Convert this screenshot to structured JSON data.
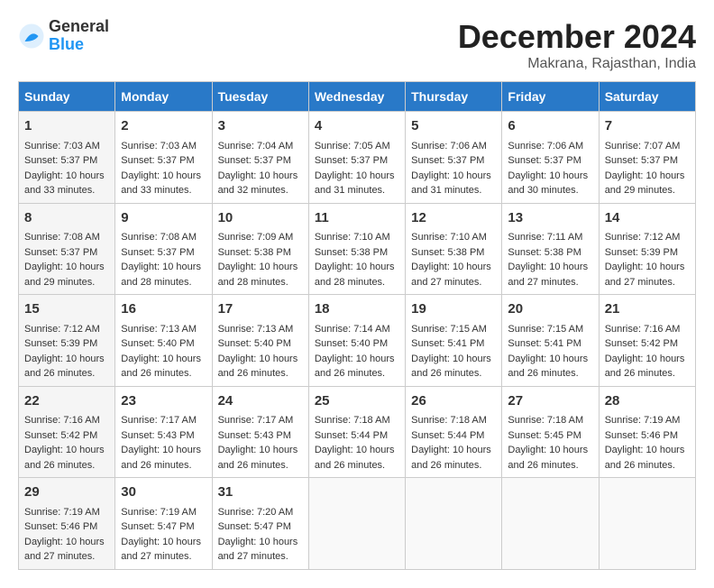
{
  "header": {
    "logo_line1": "General",
    "logo_line2": "Blue",
    "month": "December 2024",
    "location": "Makrana, Rajasthan, India"
  },
  "weekdays": [
    "Sunday",
    "Monday",
    "Tuesday",
    "Wednesday",
    "Thursday",
    "Friday",
    "Saturday"
  ],
  "weeks": [
    [
      {
        "day": "1",
        "lines": [
          "Sunrise: 7:03 AM",
          "Sunset: 5:37 PM",
          "Daylight: 10 hours",
          "and 33 minutes."
        ]
      },
      {
        "day": "2",
        "lines": [
          "Sunrise: 7:03 AM",
          "Sunset: 5:37 PM",
          "Daylight: 10 hours",
          "and 33 minutes."
        ]
      },
      {
        "day": "3",
        "lines": [
          "Sunrise: 7:04 AM",
          "Sunset: 5:37 PM",
          "Daylight: 10 hours",
          "and 32 minutes."
        ]
      },
      {
        "day": "4",
        "lines": [
          "Sunrise: 7:05 AM",
          "Sunset: 5:37 PM",
          "Daylight: 10 hours",
          "and 31 minutes."
        ]
      },
      {
        "day": "5",
        "lines": [
          "Sunrise: 7:06 AM",
          "Sunset: 5:37 PM",
          "Daylight: 10 hours",
          "and 31 minutes."
        ]
      },
      {
        "day": "6",
        "lines": [
          "Sunrise: 7:06 AM",
          "Sunset: 5:37 PM",
          "Daylight: 10 hours",
          "and 30 minutes."
        ]
      },
      {
        "day": "7",
        "lines": [
          "Sunrise: 7:07 AM",
          "Sunset: 5:37 PM",
          "Daylight: 10 hours",
          "and 29 minutes."
        ]
      }
    ],
    [
      {
        "day": "8",
        "lines": [
          "Sunrise: 7:08 AM",
          "Sunset: 5:37 PM",
          "Daylight: 10 hours",
          "and 29 minutes."
        ]
      },
      {
        "day": "9",
        "lines": [
          "Sunrise: 7:08 AM",
          "Sunset: 5:37 PM",
          "Daylight: 10 hours",
          "and 28 minutes."
        ]
      },
      {
        "day": "10",
        "lines": [
          "Sunrise: 7:09 AM",
          "Sunset: 5:38 PM",
          "Daylight: 10 hours",
          "and 28 minutes."
        ]
      },
      {
        "day": "11",
        "lines": [
          "Sunrise: 7:10 AM",
          "Sunset: 5:38 PM",
          "Daylight: 10 hours",
          "and 28 minutes."
        ]
      },
      {
        "day": "12",
        "lines": [
          "Sunrise: 7:10 AM",
          "Sunset: 5:38 PM",
          "Daylight: 10 hours",
          "and 27 minutes."
        ]
      },
      {
        "day": "13",
        "lines": [
          "Sunrise: 7:11 AM",
          "Sunset: 5:38 PM",
          "Daylight: 10 hours",
          "and 27 minutes."
        ]
      },
      {
        "day": "14",
        "lines": [
          "Sunrise: 7:12 AM",
          "Sunset: 5:39 PM",
          "Daylight: 10 hours",
          "and 27 minutes."
        ]
      }
    ],
    [
      {
        "day": "15",
        "lines": [
          "Sunrise: 7:12 AM",
          "Sunset: 5:39 PM",
          "Daylight: 10 hours",
          "and 26 minutes."
        ]
      },
      {
        "day": "16",
        "lines": [
          "Sunrise: 7:13 AM",
          "Sunset: 5:40 PM",
          "Daylight: 10 hours",
          "and 26 minutes."
        ]
      },
      {
        "day": "17",
        "lines": [
          "Sunrise: 7:13 AM",
          "Sunset: 5:40 PM",
          "Daylight: 10 hours",
          "and 26 minutes."
        ]
      },
      {
        "day": "18",
        "lines": [
          "Sunrise: 7:14 AM",
          "Sunset: 5:40 PM",
          "Daylight: 10 hours",
          "and 26 minutes."
        ]
      },
      {
        "day": "19",
        "lines": [
          "Sunrise: 7:15 AM",
          "Sunset: 5:41 PM",
          "Daylight: 10 hours",
          "and 26 minutes."
        ]
      },
      {
        "day": "20",
        "lines": [
          "Sunrise: 7:15 AM",
          "Sunset: 5:41 PM",
          "Daylight: 10 hours",
          "and 26 minutes."
        ]
      },
      {
        "day": "21",
        "lines": [
          "Sunrise: 7:16 AM",
          "Sunset: 5:42 PM",
          "Daylight: 10 hours",
          "and 26 minutes."
        ]
      }
    ],
    [
      {
        "day": "22",
        "lines": [
          "Sunrise: 7:16 AM",
          "Sunset: 5:42 PM",
          "Daylight: 10 hours",
          "and 26 minutes."
        ]
      },
      {
        "day": "23",
        "lines": [
          "Sunrise: 7:17 AM",
          "Sunset: 5:43 PM",
          "Daylight: 10 hours",
          "and 26 minutes."
        ]
      },
      {
        "day": "24",
        "lines": [
          "Sunrise: 7:17 AM",
          "Sunset: 5:43 PM",
          "Daylight: 10 hours",
          "and 26 minutes."
        ]
      },
      {
        "day": "25",
        "lines": [
          "Sunrise: 7:18 AM",
          "Sunset: 5:44 PM",
          "Daylight: 10 hours",
          "and 26 minutes."
        ]
      },
      {
        "day": "26",
        "lines": [
          "Sunrise: 7:18 AM",
          "Sunset: 5:44 PM",
          "Daylight: 10 hours",
          "and 26 minutes."
        ]
      },
      {
        "day": "27",
        "lines": [
          "Sunrise: 7:18 AM",
          "Sunset: 5:45 PM",
          "Daylight: 10 hours",
          "and 26 minutes."
        ]
      },
      {
        "day": "28",
        "lines": [
          "Sunrise: 7:19 AM",
          "Sunset: 5:46 PM",
          "Daylight: 10 hours",
          "and 26 minutes."
        ]
      }
    ],
    [
      {
        "day": "29",
        "lines": [
          "Sunrise: 7:19 AM",
          "Sunset: 5:46 PM",
          "Daylight: 10 hours",
          "and 27 minutes."
        ]
      },
      {
        "day": "30",
        "lines": [
          "Sunrise: 7:19 AM",
          "Sunset: 5:47 PM",
          "Daylight: 10 hours",
          "and 27 minutes."
        ]
      },
      {
        "day": "31",
        "lines": [
          "Sunrise: 7:20 AM",
          "Sunset: 5:47 PM",
          "Daylight: 10 hours",
          "and 27 minutes."
        ]
      },
      null,
      null,
      null,
      null
    ]
  ]
}
